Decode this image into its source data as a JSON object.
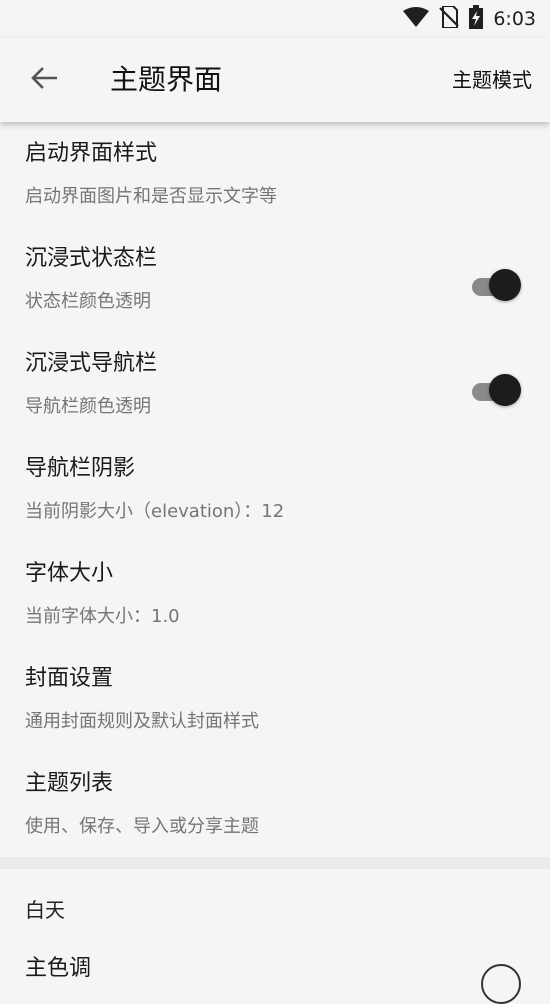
{
  "status_bar": {
    "time": "6:03",
    "icons": [
      "wifi-icon",
      "no-sim-icon",
      "battery-charging-icon"
    ]
  },
  "toolbar": {
    "title": "主题界面",
    "action_label": "主题模式",
    "back_icon": "arrow-left-icon"
  },
  "settings": [
    {
      "title": "启动界面样式",
      "subtitle": "启动界面图片和是否显示文字等"
    },
    {
      "title": "沉浸式状态栏",
      "subtitle": "状态栏颜色透明",
      "switch_on": true
    },
    {
      "title": "沉浸式导航栏",
      "subtitle": "导航栏颜色透明",
      "switch_on": true
    },
    {
      "title": "导航栏阴影",
      "subtitle": "当前阴影大小（elevation）：12"
    },
    {
      "title": "字体大小",
      "subtitle": "当前字体大小：1.0"
    },
    {
      "title": "封面设置",
      "subtitle": "通用封面规则及默认封面样式"
    },
    {
      "title": "主题列表",
      "subtitle": "使用、保存、导入或分享主题"
    }
  ],
  "section": {
    "header": "白天",
    "items": [
      {
        "title": "主色调"
      }
    ]
  },
  "colors": {
    "background": "#f5f5f5",
    "switch_thumb": "#1c1c1c",
    "switch_track": "#8a8a8a",
    "subtitle": "#757575"
  }
}
